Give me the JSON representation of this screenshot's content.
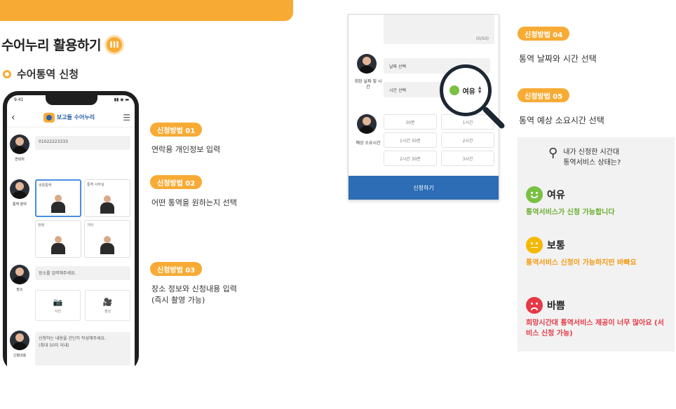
{
  "colors": {
    "accent": "#f7ab35",
    "blue": "#2c6db5",
    "green": "#7ac143",
    "yellow": "#f5b800",
    "red": "#e63946",
    "panel": "#f2f2f2"
  },
  "heading": {
    "title": "수어누리 활용하기",
    "badge": "III"
  },
  "sub_heading": {
    "title": "수어통역 신청"
  },
  "phone": {
    "status_time": "9:41",
    "status_right": "▮▮ ◉ ▬",
    "logo_text": "보고들 수어누리",
    "contact": {
      "label": "연락처",
      "value": "01022223333"
    },
    "type": {
      "label": "통역 분야",
      "options": [
        "생활통역",
        "통역 사무실",
        "전화",
        "기타"
      ]
    },
    "place": {
      "label": "장소",
      "placeholder": "장소를 입력해주세요.",
      "photo": "사진",
      "video": "영상"
    },
    "request": {
      "label": "신청내용",
      "placeholder": "신청하는 내용을 간단히 작성해주세요.",
      "hint": "(최대 50자 이내)"
    }
  },
  "steps_left": [
    {
      "pill": "신청방법 01",
      "desc": "연락용 개인정보 입력"
    },
    {
      "pill": "신청방법 02",
      "desc": "어떤 통역을 원하는지 선택"
    },
    {
      "pill": "신청방법 03",
      "desc": "장소 정보와 신청내용 입력",
      "desc2": "(즉시 촬영 가능)"
    }
  ],
  "phone2": {
    "memo_count": "(0/50)",
    "date_row_label": "희망 날짜 및 시간",
    "date_select": "날짜 선택",
    "time_select": "시간 선택",
    "duration_label": "예상 소요시간",
    "durations": [
      "30분",
      "1시간",
      "1시간 30분",
      "2시간",
      "2시간 30분",
      "3시간"
    ],
    "submit": "신청하기"
  },
  "magnifier": {
    "status": "여유"
  },
  "steps_right": [
    {
      "pill": "신청방법 04",
      "desc": "통역 날짜와 시간 선택"
    },
    {
      "pill": "신청방법 05",
      "desc": "통역 예상 소요시간 선택"
    }
  ],
  "status_panel": {
    "question_line1": "내가 신청한 시간대",
    "question_line2": "통역서비스 상태는?",
    "items": [
      {
        "title": "여유",
        "desc": "통역서비스가 신청 가능합니다"
      },
      {
        "title": "보통",
        "desc": "통역서비스 신청이 가능하지만 바빠요"
      },
      {
        "title": "바쁨",
        "desc": "희망시간대 통역서비스 제공이 너무 많아요 (서비스 신청 가능)"
      }
    ]
  }
}
